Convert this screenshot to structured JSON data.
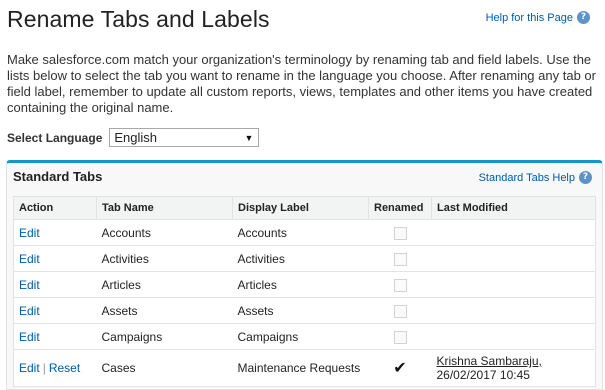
{
  "page": {
    "title": "Rename Tabs and Labels",
    "help_label": "Help for this Page",
    "intro": "Make salesforce.com match your organization's terminology by renaming tab and field labels. Use the lists below to select the tab you want to rename in the language you choose. After renaming any tab or field label, remember to update all custom reports, views, templates and other items you have created containing the original name."
  },
  "language": {
    "label": "Select Language",
    "selected": "English"
  },
  "panel": {
    "title": "Standard Tabs",
    "help_label": "Standard Tabs Help"
  },
  "table": {
    "headers": [
      "Action",
      "Tab Name",
      "Display Label",
      "Renamed",
      "Last Modified"
    ],
    "rows": [
      {
        "edit": "Edit",
        "tab_name": "Accounts",
        "display_label": "Accounts",
        "renamed": false
      },
      {
        "edit": "Edit",
        "tab_name": "Activities",
        "display_label": "Activities",
        "renamed": false
      },
      {
        "edit": "Edit",
        "tab_name": "Articles",
        "display_label": "Articles",
        "renamed": false
      },
      {
        "edit": "Edit",
        "tab_name": "Assets",
        "display_label": "Assets",
        "renamed": false
      },
      {
        "edit": "Edit",
        "tab_name": "Campaigns",
        "display_label": "Campaigns",
        "renamed": false
      },
      {
        "edit": "Edit",
        "reset": "Reset",
        "tab_name": "Cases",
        "display_label": "Maintenance Requests",
        "renamed": true,
        "modified_by": "Krishna Sambaraju,",
        "modified_date": "26/02/2017 10:45"
      }
    ]
  },
  "colors": {
    "link": "#015ba7",
    "panel_accent": "#1797c0"
  }
}
